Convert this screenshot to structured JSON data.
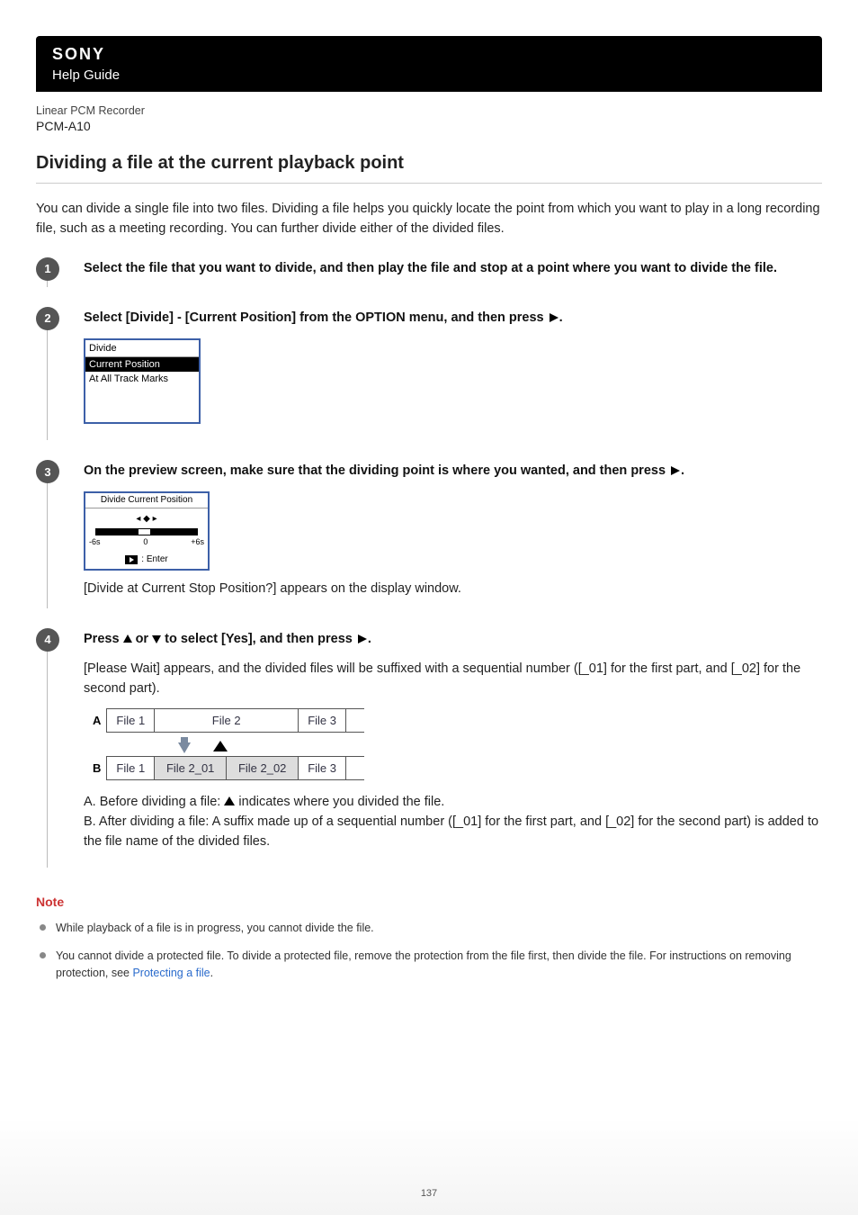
{
  "header": {
    "brand": "SONY",
    "help_guide": "Help Guide",
    "product_line": "Linear PCM Recorder",
    "model": "PCM-A10"
  },
  "title": "Dividing a file at the current playback point",
  "intro": "You can divide a single file into two files. Dividing a file helps you quickly locate the point from which you want to play in a long recording file, such as a meeting recording. You can further divide either of the divided files.",
  "steps": [
    {
      "num": "1",
      "title": "Select the file that you want to divide, and then play the file and stop at a point where you want to divide the file."
    },
    {
      "num": "2",
      "title_pre": "Select [Divide] - [Current Position] from the OPTION menu, and then press ",
      "title_post": ".",
      "lcd": {
        "title": "Divide",
        "selected": "Current Position",
        "row2": "At All Track Marks"
      }
    },
    {
      "num": "3",
      "title_pre": "On the preview screen, make sure that the dividing point is where you wanted, and then press ",
      "title_post": ".",
      "lcd2": {
        "title": "Divide Current Position",
        "scale_left": "-6s",
        "scale_mid": "0",
        "scale_right": "+6s",
        "enter": ": Enter"
      },
      "body": "[Divide at Current Stop Position?] appears on the display window."
    },
    {
      "num": "4",
      "title_pre": "Press ",
      "title_mid": " or ",
      "title_mid2": " to select [Yes], and then press ",
      "title_post": ".",
      "body": "[Please Wait] appears, and the divided files will be suffixed with a sequential number ([_01] for the first part, and [_02] for the second part).",
      "diagram": {
        "rowA_label": "A",
        "rowA": [
          "File 1",
          "File 2",
          "File 3"
        ],
        "rowB_label": "B",
        "rowB": [
          "File 1",
          "File 2_01",
          "File 2_02",
          "File 3"
        ]
      },
      "descA_pre": "A. Before dividing a file: ",
      "descA_post": " indicates where you divided the file.",
      "descB": "B. After dividing a file: A suffix made up of a sequential number ([_01] for the first part, and [_02] for the second part) is added to the file name of the divided files."
    }
  ],
  "note": {
    "heading": "Note",
    "items": [
      "While playback of a file is in progress, you cannot divide the file.",
      {
        "pre": "You cannot divide a protected file. To divide a protected file, remove the protection from the file first, then divide the file. For instructions on removing protection, see ",
        "link": "Protecting a file",
        "post": "."
      }
    ]
  },
  "page_number": "137"
}
